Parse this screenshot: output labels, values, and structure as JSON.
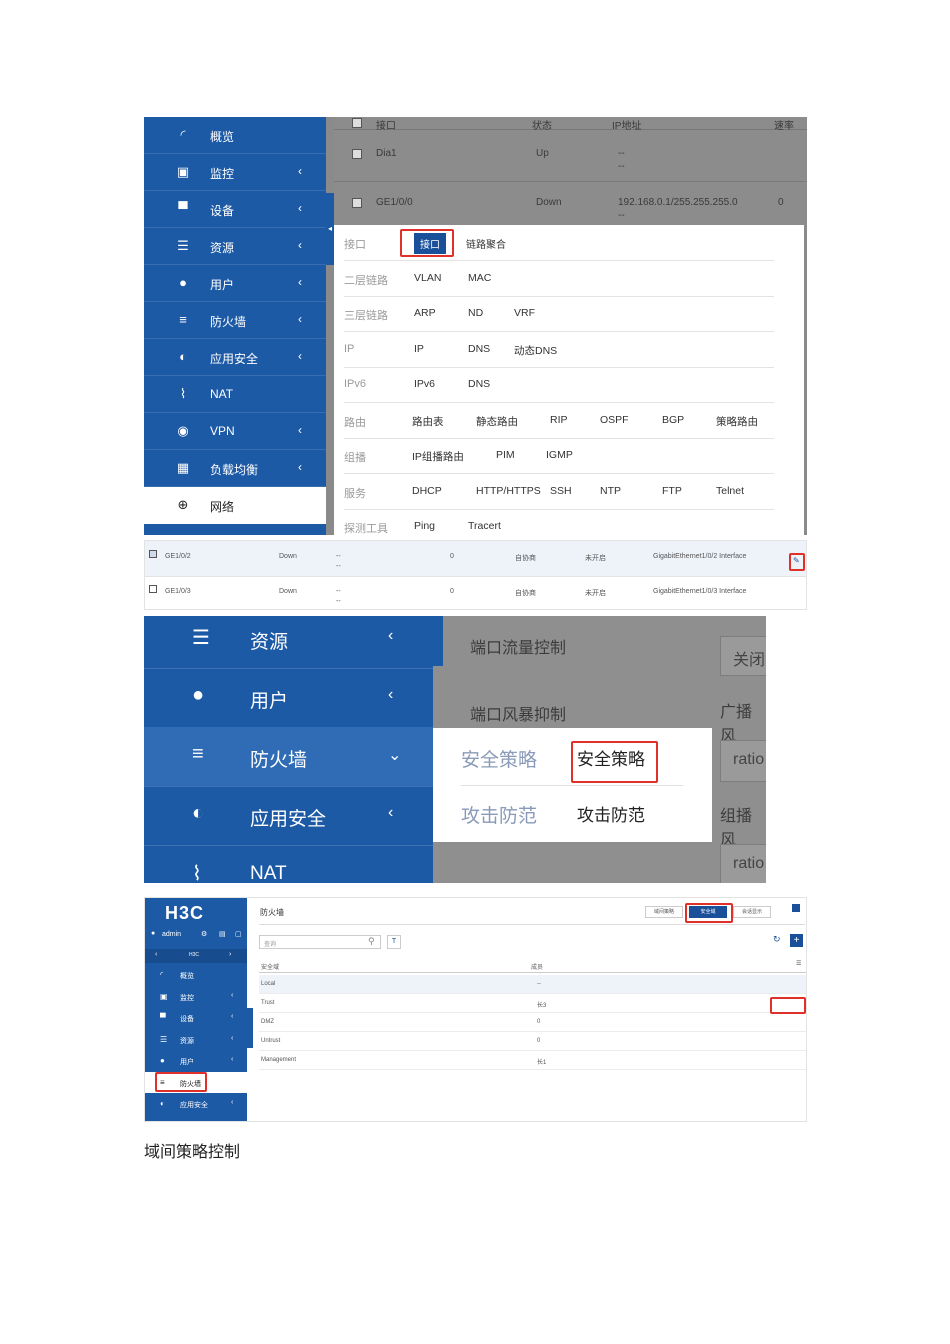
{
  "shot1": {
    "sidebar": [
      {
        "icon": "dashboard-icon",
        "glyph": "◜",
        "label": "概览",
        "chevron": ""
      },
      {
        "icon": "monitor-icon",
        "glyph": "▣",
        "label": "监控",
        "chevron": "‹"
      },
      {
        "icon": "device-icon",
        "glyph": "▀",
        "label": "设备",
        "chevron": "‹"
      },
      {
        "icon": "resource-icon",
        "glyph": "☰",
        "label": "资源",
        "chevron": "‹"
      },
      {
        "icon": "user-icon",
        "glyph": "●",
        "label": "用户",
        "chevron": "‹"
      },
      {
        "icon": "firewall-icon",
        "glyph": "≡",
        "label": "防火墙",
        "chevron": "‹"
      },
      {
        "icon": "app-security-icon",
        "glyph": "◐",
        "label": "应用安全",
        "chevron": "‹"
      },
      {
        "icon": "nat-icon",
        "glyph": "⌇",
        "label": "NAT",
        "chevron": ""
      },
      {
        "icon": "vpn-icon",
        "glyph": "◉",
        "label": "VPN",
        "chevron": "‹"
      },
      {
        "icon": "load-balance-icon",
        "glyph": "▦",
        "label": "负载均衡",
        "chevron": "‹"
      },
      {
        "icon": "network-globe-icon",
        "glyph": "⊕",
        "label": "网络",
        "chevron": ""
      }
    ],
    "bg_table": {
      "headers": [
        "接口",
        "状态",
        "IP地址",
        "速率"
      ],
      "rows": [
        {
          "name": "Dia1",
          "status": "Up",
          "ip": "--",
          "dash": "--",
          "rate": ""
        },
        {
          "name": "GE1/0/0",
          "status": "Down",
          "ip": "192.168.0.1/255.255.255.0",
          "dash": "--",
          "rate": "0"
        }
      ]
    },
    "menu": [
      {
        "cat": "接口",
        "items": [
          "接口",
          "链路聚合"
        ]
      },
      {
        "cat": "二层链路",
        "items": [
          "VLAN",
          "MAC"
        ]
      },
      {
        "cat": "三层链路",
        "items": [
          "ARP",
          "ND",
          "VRF"
        ]
      },
      {
        "cat": "IP",
        "items": [
          "IP",
          "DNS",
          "动态DNS"
        ]
      },
      {
        "cat": "IPv6",
        "items": [
          "IPv6",
          "DNS"
        ]
      },
      {
        "cat": "路由",
        "items": [
          "路由表",
          "静态路由",
          "RIP",
          "OSPF",
          "BGP",
          "策略路由"
        ]
      },
      {
        "cat": "组播",
        "items": [
          "IP组播路由",
          "PIM",
          "IGMP"
        ]
      },
      {
        "cat": "服务",
        "items": [
          "DHCP",
          "HTTP/HTTPS",
          "SSH",
          "NTP",
          "FTP",
          "Telnet"
        ]
      },
      {
        "cat": "探测工具",
        "items": [
          "Ping",
          "Tracert"
        ]
      }
    ],
    "bottom_rows": [
      {
        "name": "GE1/0/2",
        "status": "Down",
        "ip": "--",
        "ip2": "--",
        "rate": "0",
        "duplex": "自协商",
        "flow": "未开启",
        "desc": "GigabitEthernet1/0/2 Interface"
      },
      {
        "name": "GE1/0/3",
        "status": "Down",
        "ip": "--",
        "ip2": "--",
        "rate": "0",
        "duplex": "自协商",
        "flow": "未开启",
        "desc": "GigabitEthernet1/0/3 Interface"
      }
    ]
  },
  "shot2": {
    "sidebar": [
      {
        "icon": "resource-icon",
        "glyph": "☰",
        "label": "资源",
        "chevron": "‹"
      },
      {
        "icon": "user-icon",
        "glyph": "●",
        "label": "用户",
        "chevron": "‹"
      },
      {
        "icon": "firewall-icon",
        "glyph": "≡",
        "label": "防火墙",
        "chevron": "⌄"
      },
      {
        "icon": "app-security-icon",
        "glyph": "◐",
        "label": "应用安全",
        "chevron": "‹"
      },
      {
        "icon": "nat-icon",
        "glyph": "⌇",
        "label": "NAT",
        "chevron": ""
      }
    ],
    "bg_labels": {
      "flow_control": "端口流量控制",
      "storm_control": "端口风暴抑制",
      "close": "关闭",
      "broadcast": "广播风",
      "ratio1": "ratio",
      "multicast": "组播风",
      "ratio2": "ratio"
    },
    "popup": [
      {
        "cat": "安全策略",
        "item": "安全策略"
      },
      {
        "cat": "攻击防范",
        "item": "攻击防范"
      }
    ]
  },
  "shot3": {
    "logo": "H3C",
    "user": "admin",
    "nav_label": "H3C",
    "sidebar": [
      {
        "icon": "dashboard-icon",
        "glyph": "◜",
        "label": "概览",
        "chevron": ""
      },
      {
        "icon": "monitor-icon",
        "glyph": "▣",
        "label": "监控",
        "chevron": "‹"
      },
      {
        "icon": "device-icon",
        "glyph": "▀",
        "label": "设备",
        "chevron": "‹"
      },
      {
        "icon": "resource-icon",
        "glyph": "☰",
        "label": "资源",
        "chevron": "‹"
      },
      {
        "icon": "user-icon",
        "glyph": "●",
        "label": "用户",
        "chevron": "‹"
      },
      {
        "icon": "firewall-icon",
        "glyph": "≡",
        "label": "防火墙",
        "chevron": ""
      },
      {
        "icon": "app-security-icon",
        "glyph": "◐",
        "label": "应用安全",
        "chevron": "‹"
      }
    ],
    "breadcrumb": "防火墙",
    "tabs": [
      "域间策略",
      "安全域",
      "会话显示"
    ],
    "search_placeholder": "查询",
    "filter_glyph": "T",
    "headers": [
      "安全域",
      "成员"
    ],
    "rows": [
      {
        "zone": "Local",
        "member": "--"
      },
      {
        "zone": "Trust",
        "member": "长3"
      },
      {
        "zone": "DMZ",
        "member": "0"
      },
      {
        "zone": "Untrust",
        "member": "0"
      },
      {
        "zone": "Management",
        "member": "长1"
      }
    ]
  },
  "caption": "域间策略控制",
  "colors": {
    "sidebar": "#1d5aa6",
    "highlight": "#e0302a",
    "active_tab": "#1a4f99"
  }
}
